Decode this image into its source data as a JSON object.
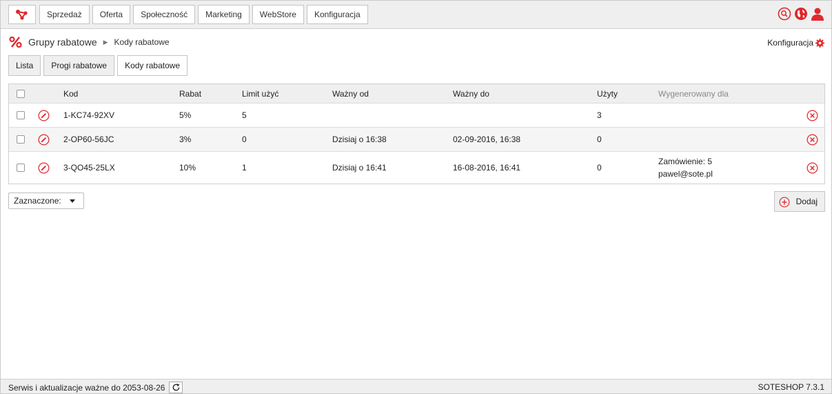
{
  "nav": [
    "Sprzedaż",
    "Oferta",
    "Społeczność",
    "Marketing",
    "WebStore",
    "Konfiguracja"
  ],
  "colors": {
    "accent": "#e0282e"
  },
  "breadcrumb": {
    "section": "Grupy rabatowe",
    "page": "Kody rabatowe"
  },
  "config_link": "Konfiguracja",
  "tabs": [
    "Lista",
    "Progi rabatowe",
    "Kody rabatowe"
  ],
  "table": {
    "columns": [
      "Kod",
      "Rabat",
      "Limit użyć",
      "Ważny od",
      "Ważny do",
      "Użyty",
      "Wygenerowany dla"
    ],
    "rows": [
      {
        "kod": "1-KC74-92XV",
        "rabat": "5%",
        "limit": "5",
        "od": "",
        "do": "",
        "uzyty": "3",
        "gen1": "",
        "gen2": ""
      },
      {
        "kod": "2-OP60-56JC",
        "rabat": "3%",
        "limit": "0",
        "od": "Dzisiaj o 16:38",
        "do": "02-09-2016, 16:38",
        "uzyty": "0",
        "gen1": "",
        "gen2": ""
      },
      {
        "kod": "3-QO45-25LX",
        "rabat": "10%",
        "limit": "1",
        "od": "Dzisiaj o 16:41",
        "do": "16-08-2016, 16:41",
        "uzyty": "0",
        "gen1": "Zamówienie: 5",
        "gen2": "pawel@sote.pl"
      }
    ]
  },
  "selected_label": "Zaznaczone:",
  "add_label": "Dodaj",
  "footer": {
    "service": "Serwis i aktualizacje ważne do 2053-08-26",
    "version": "SOTESHOP 7.3.1"
  }
}
